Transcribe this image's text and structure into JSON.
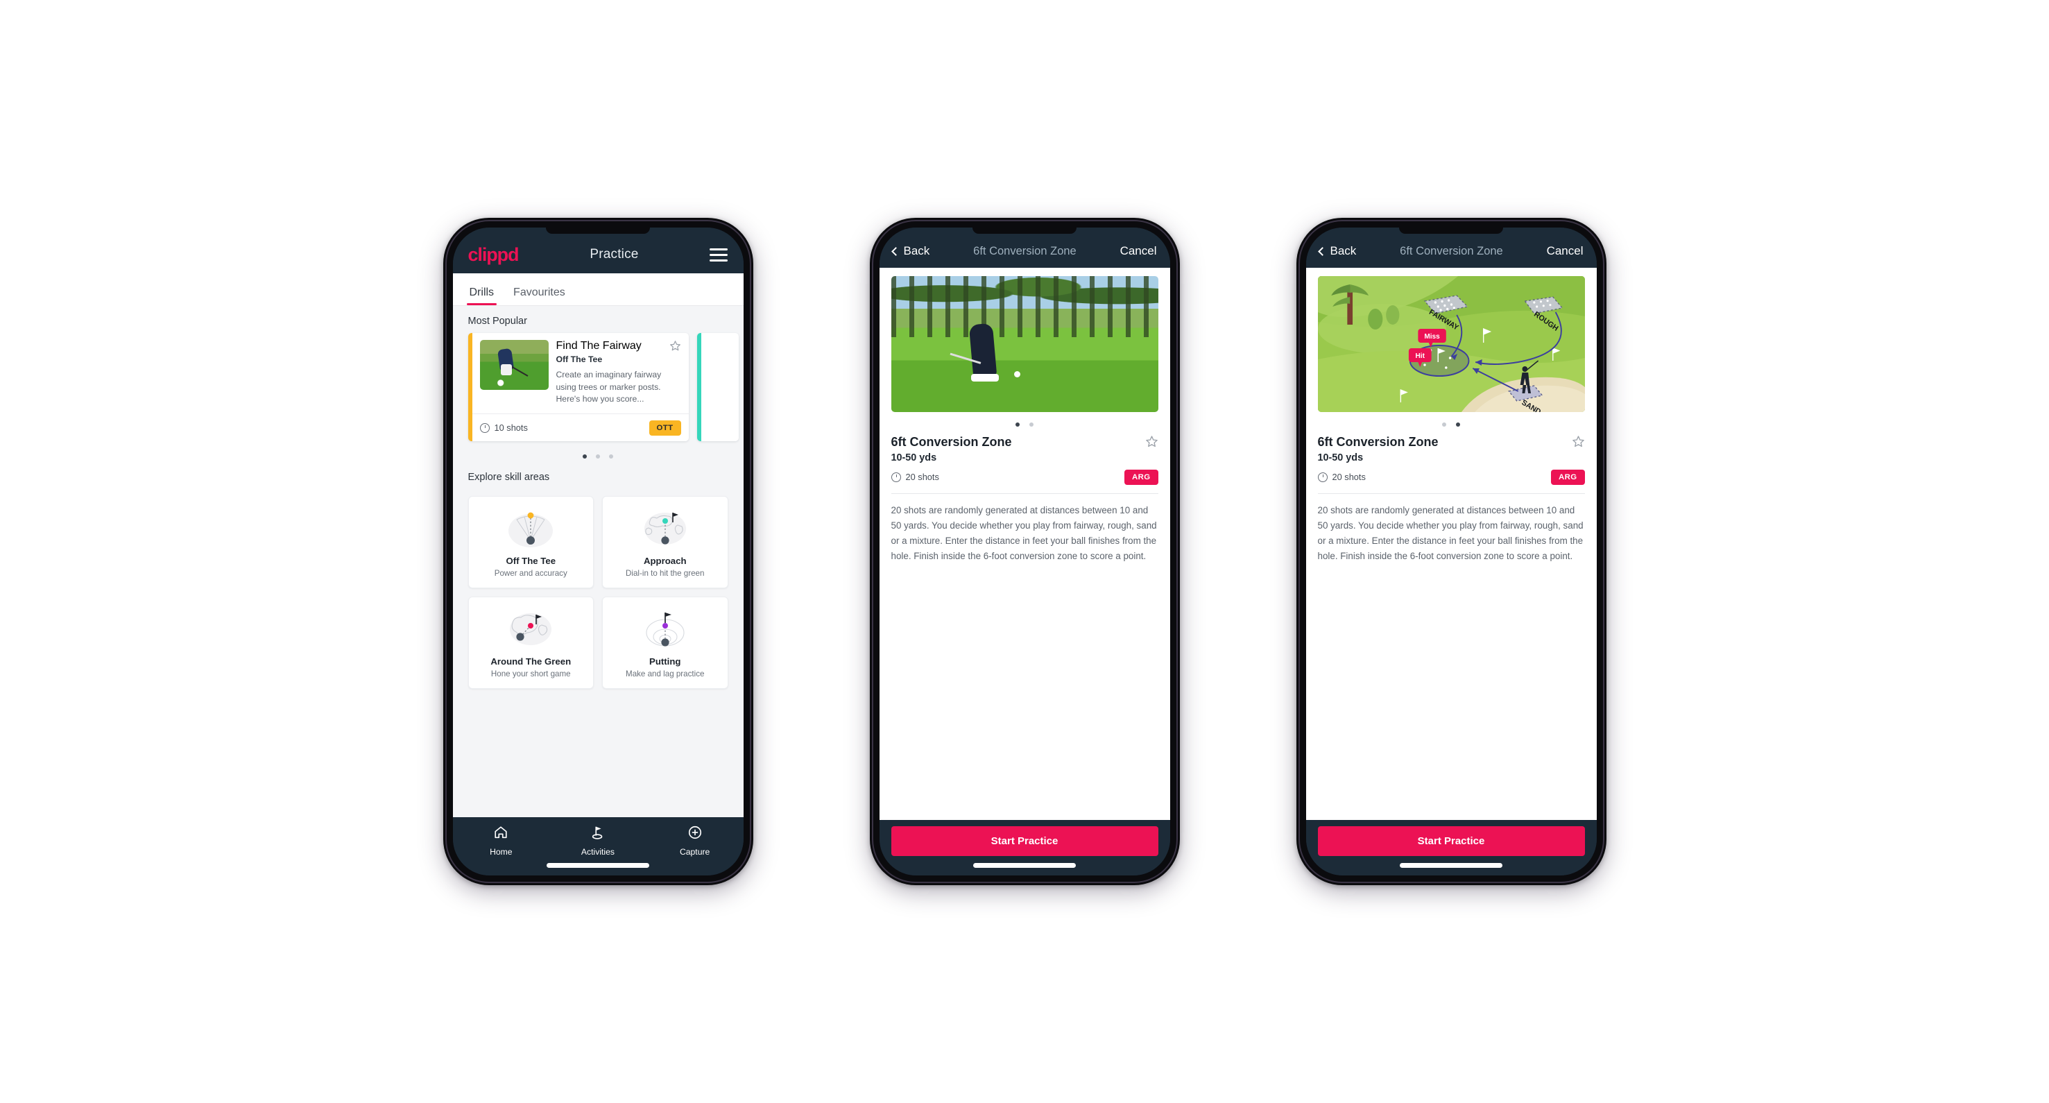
{
  "app": {
    "brand": "clippd",
    "accent_pink": "#ec1254",
    "accent_amber": "#f9b523",
    "accent_teal": "#35d6bb",
    "navy": "#1c2b38"
  },
  "phone1": {
    "appbar": {
      "title": "Practice",
      "menu_icon": "hamburger-icon"
    },
    "tabs": [
      {
        "label": "Drills",
        "active": true
      },
      {
        "label": "Favourites",
        "active": false
      }
    ],
    "most_popular": {
      "section_title": "Most Popular",
      "card": {
        "title": "Find The Fairway",
        "subtitle": "Off The Tee",
        "description": "Create an imaginary fairway using trees or marker posts. Here's how you score...",
        "shots": "10 shots",
        "badge": "OTT",
        "accent": "#f9b523",
        "star_icon": "star-outline-icon",
        "clock_icon": "clock-icon"
      },
      "carousel_dots": {
        "count": 3,
        "active_index": 0
      }
    },
    "explore": {
      "section_title": "Explore skill areas",
      "cards": [
        {
          "name": "Off The Tee",
          "desc": "Power and accuracy",
          "icon": "off-the-tee-icon",
          "dot_color": "#f9b523"
        },
        {
          "name": "Approach",
          "desc": "Dial-in to hit the green",
          "icon": "approach-icon",
          "dot_color": "#35d6bb"
        },
        {
          "name": "Around The Green",
          "desc": "Hone your short game",
          "icon": "around-the-green-icon",
          "dot_color": "#ec1254"
        },
        {
          "name": "Putting",
          "desc": "Make and lag practice",
          "icon": "putting-icon",
          "dot_color": "#9b30d9"
        }
      ]
    },
    "tabbar": [
      {
        "label": "Home",
        "icon": "home-icon",
        "active": false
      },
      {
        "label": "Activities",
        "icon": "golf-flag-icon",
        "active": true
      },
      {
        "label": "Capture",
        "icon": "plus-circle-icon",
        "active": false
      }
    ]
  },
  "phone2": {
    "navbar": {
      "back": "Back",
      "title": "6ft Conversion Zone",
      "cancel": "Cancel",
      "back_icon": "chevron-left-icon"
    },
    "hero": {
      "type": "photo",
      "alt": "golfer-chipping-photo"
    },
    "hero_dots": {
      "count": 2,
      "active_index": 0
    },
    "detail": {
      "title": "6ft Conversion Zone",
      "yards": "10-50 yds",
      "shots": "20 shots",
      "badge": "ARG",
      "star_icon": "star-outline-icon",
      "clock_icon": "clock-icon",
      "description": "20 shots are randomly generated at distances between 10 and 50 yards. You decide whether you play from fairway, rough, sand or a mixture. Enter the distance in feet your ball finishes from the hole. Finish inside the 6-foot conversion zone to score a point."
    },
    "cta": "Start Practice"
  },
  "phone3": {
    "navbar": {
      "back": "Back",
      "title": "6ft Conversion Zone",
      "cancel": "Cancel",
      "back_icon": "chevron-left-icon"
    },
    "hero": {
      "type": "illustration",
      "alt": "golf-hole-diagram",
      "labels": [
        "FAIRWAY",
        "ROUGH",
        "SAND"
      ],
      "callouts": [
        "Miss",
        "Hit"
      ]
    },
    "hero_dots": {
      "count": 2,
      "active_index": 1
    },
    "detail": {
      "title": "6ft Conversion Zone",
      "yards": "10-50 yds",
      "shots": "20 shots",
      "badge": "ARG",
      "star_icon": "star-outline-icon",
      "clock_icon": "clock-icon",
      "description": "20 shots are randomly generated at distances between 10 and 50 yards. You decide whether you play from fairway, rough, sand or a mixture. Enter the distance in feet your ball finishes from the hole. Finish inside the 6-foot conversion zone to score a point."
    },
    "cta": "Start Practice"
  }
}
